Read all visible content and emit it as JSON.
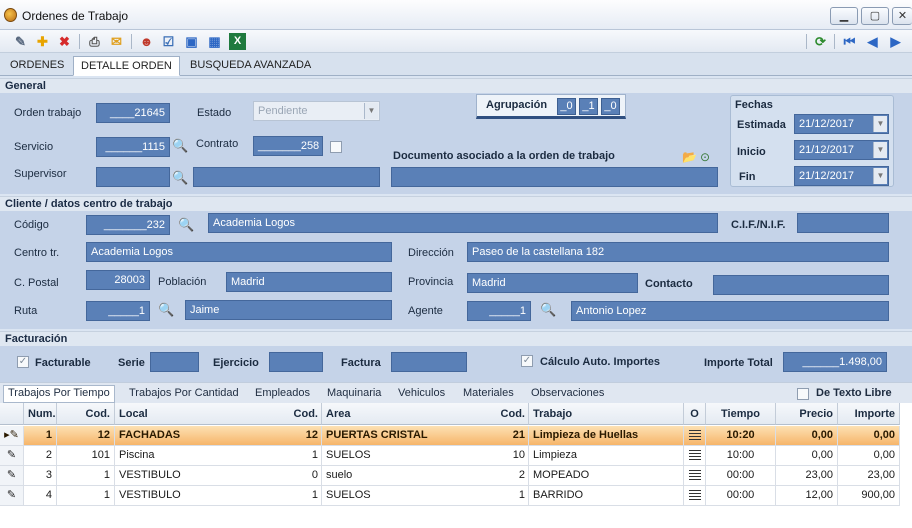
{
  "window": {
    "title": "Ordenes de Trabajo"
  },
  "toolbar": {
    "icons": [
      "edit-icon",
      "add-icon",
      "delete-icon",
      "print-icon",
      "mail-icon",
      "users-icon",
      "checklist-icon",
      "window-icon",
      "calendar-icon",
      "excel-icon",
      "refresh-icon",
      "first-icon",
      "prev-icon",
      "next-icon"
    ]
  },
  "tabs": [
    "ORDENES",
    "DETALLE ORDEN",
    "BUSQUEDA AVANZADA"
  ],
  "general": {
    "section": "General",
    "orden_label": "Orden trabajo",
    "orden": "____21645",
    "estado_label": "Estado",
    "estado": "Pendiente",
    "agrupacion_label": "Agrupación",
    "agrupacion": [
      "_0",
      "_1",
      "_0"
    ],
    "servicio_label": "Servicio",
    "servicio": "______1115",
    "contrato_label": "Contrato",
    "contrato": "_______258",
    "supervisor_label": "Supervisor",
    "supervisor_code": "",
    "supervisor_name": "",
    "documento_label": "Documento asociado a la orden de trabajo",
    "documento": ""
  },
  "fechas": {
    "title": "Fechas",
    "estimada_label": "Estimada",
    "estimada": "21/12/2017",
    "inicio_label": "Inicio",
    "inicio": "21/12/2017",
    "fin_label": "Fin",
    "fin": "21/12/2017"
  },
  "cliente": {
    "section": "Cliente / datos centro de trabajo",
    "codigo_label": "Código",
    "codigo": "_______232",
    "nombre": "Academia Logos",
    "cif_label": "C.I.F./N.I.F.",
    "cif": "",
    "centro_label": "Centro tr.",
    "centro": "Academia Logos",
    "direccion_label": "Dirección",
    "direccion": "Paseo de la castellana 182",
    "cpostal_label": "C. Postal",
    "cpostal": "28003",
    "poblacion_label": "Población",
    "poblacion": "Madrid",
    "provincia_label": "Provincia",
    "provincia": "Madrid",
    "contacto_label": "Contacto",
    "contacto": "",
    "ruta_label": "Ruta",
    "ruta": "_____1",
    "ruta_name": "Jaime",
    "agente_label": "Agente",
    "agente": "_____1",
    "agente_name": "Antonio Lopez"
  },
  "facturacion": {
    "section": "Facturación",
    "facturable_label": "Facturable",
    "facturable": true,
    "serie_label": "Serie",
    "serie": "",
    "ejercicio_label": "Ejercicio",
    "ejercicio": "",
    "factura_label": "Factura",
    "factura": "",
    "calculo_label": "Cálculo Auto. Importes",
    "calculo": true,
    "importe_label": "Importe Total",
    "importe": "______1.498,00"
  },
  "subtabs": [
    "Trabajos Por Tiempo",
    "Trabajos Por Cantidad",
    "Empleados",
    "Maquinaria",
    "Vehiculos",
    "Materiales",
    "Observaciones"
  ],
  "texto_libre_label": "De Texto Libre",
  "grid": {
    "headers": [
      "Num.",
      "Cod.",
      "Local",
      "Cod.",
      "Area",
      "Cod.",
      "Trabajo",
      "O",
      "Tiempo",
      "Precio",
      "Importe"
    ],
    "rows": [
      [
        "1",
        "12",
        "FACHADAS",
        "12",
        "PUERTAS CRISTAL",
        "21",
        "Limpieza de Huellas",
        "",
        "10:20",
        "0,00",
        "0,00"
      ],
      [
        "2",
        "101",
        "Piscina",
        "1",
        "SUELOS",
        "10",
        "Limpieza",
        "",
        "10:00",
        "0,00",
        "0,00"
      ],
      [
        "3",
        "1",
        "VESTIBULO",
        "0",
        "suelo",
        "2",
        "MOPEADO",
        "",
        "00:00",
        "23,00",
        "23,00"
      ],
      [
        "4",
        "1",
        "VESTIBULO",
        "1",
        "SUELOS",
        "1",
        "BARRIDO",
        "",
        "00:00",
        "12,00",
        "900,00"
      ]
    ]
  }
}
